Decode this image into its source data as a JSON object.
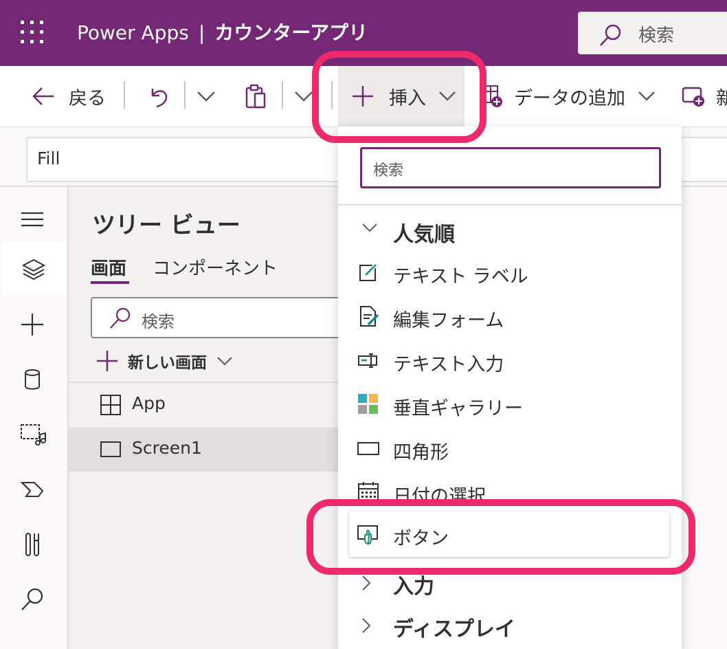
{
  "header": {
    "product": "Power Apps",
    "separator": "|",
    "app_name": "カウンターアプリ",
    "search_placeholder": "検索",
    "bg_color": "#742774"
  },
  "toolbar": {
    "back_label": "戻る",
    "insert_label": "挿入",
    "add_data_label": "データの追加",
    "new_label_partial": "新"
  },
  "formula_bar": {
    "property": "Fill"
  },
  "left_rail": {
    "items": [
      "hamburger-icon",
      "tree-view-icon",
      "insert-icon",
      "data-icon",
      "media-icon",
      "power-automate-icon",
      "tools-icon",
      "search-icon"
    ],
    "active": "tree-view-icon"
  },
  "tree_view": {
    "title": "ツリー ビュー",
    "tabs": [
      {
        "label": "画面",
        "active": true
      },
      {
        "label": "コンポーネント",
        "active": false
      }
    ],
    "search_placeholder": "検索",
    "new_screen_label": "新しい画面",
    "nodes": [
      {
        "label": "App",
        "icon": "app-icon",
        "selected": false
      },
      {
        "label": "Screen1",
        "icon": "screen-icon",
        "selected": true
      }
    ]
  },
  "insert_menu": {
    "search_placeholder": "検索",
    "categories": [
      {
        "label": "人気順",
        "expanded": true
      },
      {
        "label": "入力",
        "expanded": false
      },
      {
        "label": "ディスプレイ",
        "expanded": false
      }
    ],
    "popular_items": [
      {
        "label": "テキスト ラベル",
        "icon": "text-label-icon"
      },
      {
        "label": "編集フォーム",
        "icon": "edit-form-icon"
      },
      {
        "label": "テキスト入力",
        "icon": "text-input-icon"
      },
      {
        "label": "垂直ギャラリー",
        "icon": "vertical-gallery-icon"
      },
      {
        "label": "四角形",
        "icon": "rectangle-icon"
      },
      {
        "label": "日付の選択",
        "icon": "date-picker-icon"
      },
      {
        "label": "ボタン",
        "icon": "button-icon",
        "hovered": true
      }
    ]
  },
  "colors": {
    "accent": "#742774",
    "highlight": "#ee2a6b",
    "teal": "#0f8f7e"
  }
}
